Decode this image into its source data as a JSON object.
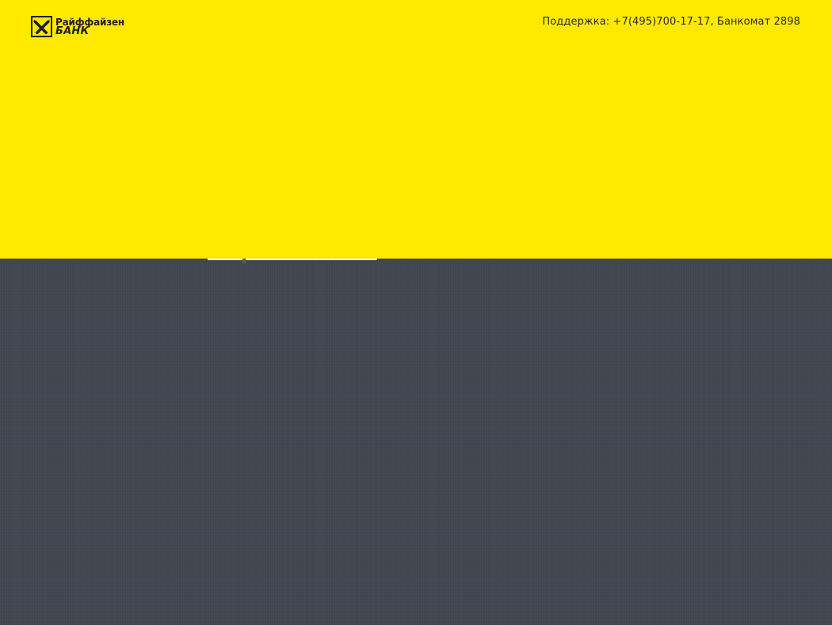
{
  "header": {
    "logo": {
      "line1": "Райффайзен",
      "line2": "БАНК",
      "icon": "raiffeisen-gable-cross-icon"
    },
    "support_text": "Поддержка: +7(495)700-17-17, Банкомат 2898"
  },
  "colors": {
    "brand_yellow": "#FFE900",
    "body_background": "#424650",
    "text_dark": "#2b2b2b"
  }
}
